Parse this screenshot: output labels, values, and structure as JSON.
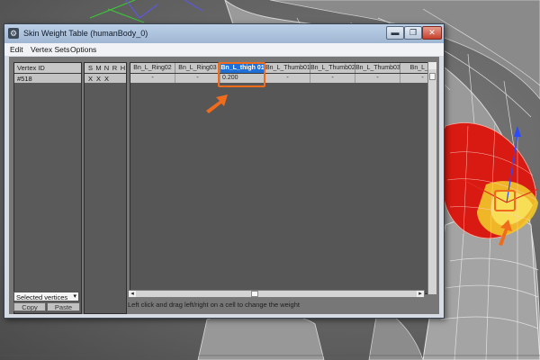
{
  "window": {
    "title": "Skin Weight Table (humanBody_0)",
    "icon_text": "⚙",
    "minimize": "▬",
    "maximize": "❐",
    "close": "✕"
  },
  "menu": {
    "edit": "Edit",
    "vertex_sets": "Vertex Sets",
    "options": "Options"
  },
  "left_panel": {
    "header": "Vertex ID",
    "rows": [
      {
        "id": "#518"
      }
    ]
  },
  "flags": {
    "headers": [
      "S",
      "M",
      "N",
      "R",
      "H"
    ],
    "row": [
      "X",
      "X",
      "X",
      "",
      ""
    ]
  },
  "grid": {
    "columns": [
      "Bn_L_Ring02",
      "Bn_L_Ring03",
      "Bn_L_thigh 01",
      "Bn_L_Thumb01",
      "Bn_L_Thumb02",
      "Bn_L_Thumb03",
      "Bn_L_To"
    ],
    "selected_column": "Bn_L_thigh 01",
    "row": [
      "-",
      "-",
      "0.200",
      "-",
      "-",
      "-",
      "-"
    ]
  },
  "status": "Left click and drag left/right on a cell to change the weight",
  "controls": {
    "selection_mode": "Selected vertices",
    "copy": "Copy",
    "paste": "Paste"
  },
  "colors": {
    "highlight": "#f06b1c",
    "selected_header": "#1f6fd6"
  },
  "icons": [
    "gear-icon",
    "chevron-down-icon",
    "arrow-left-icon",
    "arrow-right-icon"
  ]
}
